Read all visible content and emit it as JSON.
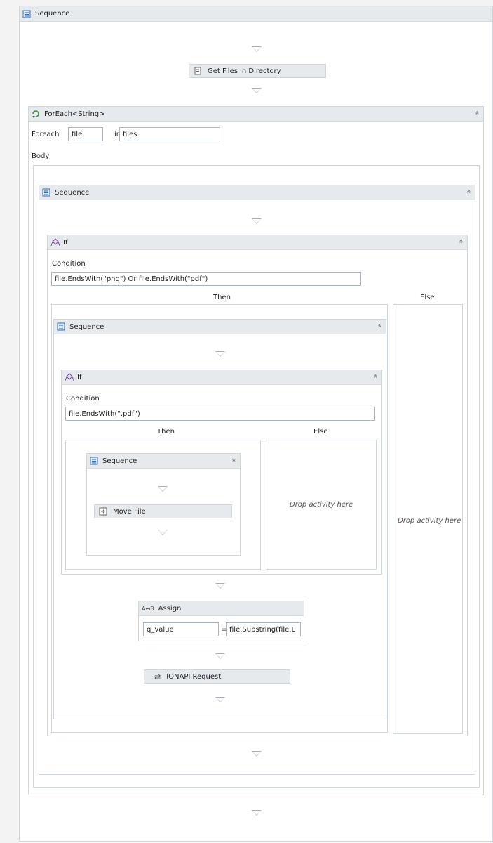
{
  "root": {
    "title": "Sequence"
  },
  "get_files": {
    "label": "Get Files in Directory"
  },
  "foreach": {
    "title": "ForEach<String>",
    "foreach_label": "Foreach",
    "item_value": "file",
    "in_label": "in",
    "collection_value": "files",
    "body_label": "Body"
  },
  "seq_outer": {
    "title": "Sequence"
  },
  "if_outer": {
    "title": "If",
    "condition_label": "Condition",
    "condition_value": "file.EndsWith(\"png\") Or file.EndsWith(\"pdf\")",
    "then_label": "Then",
    "else_label": "Else",
    "else_drop": "Drop activity here"
  },
  "seq_then": {
    "title": "Sequence"
  },
  "if_inner": {
    "title": "If",
    "condition_label": "Condition",
    "condition_value": "file.EndsWith(\".pdf\")",
    "then_label": "Then",
    "else_label": "Else",
    "else_drop": "Drop activity here"
  },
  "seq_inner": {
    "title": "Sequence"
  },
  "move_file": {
    "label": "Move File"
  },
  "assign": {
    "title": "Assign",
    "to_value": "q_value",
    "equals": "=",
    "expr_value": "file.Substring(file.L"
  },
  "ionapi": {
    "label": "IONAPI Request"
  },
  "icons": {
    "collapse": "«",
    "sequence": "sequence-icon",
    "if": "if-icon",
    "foreach": "foreach-icon"
  }
}
